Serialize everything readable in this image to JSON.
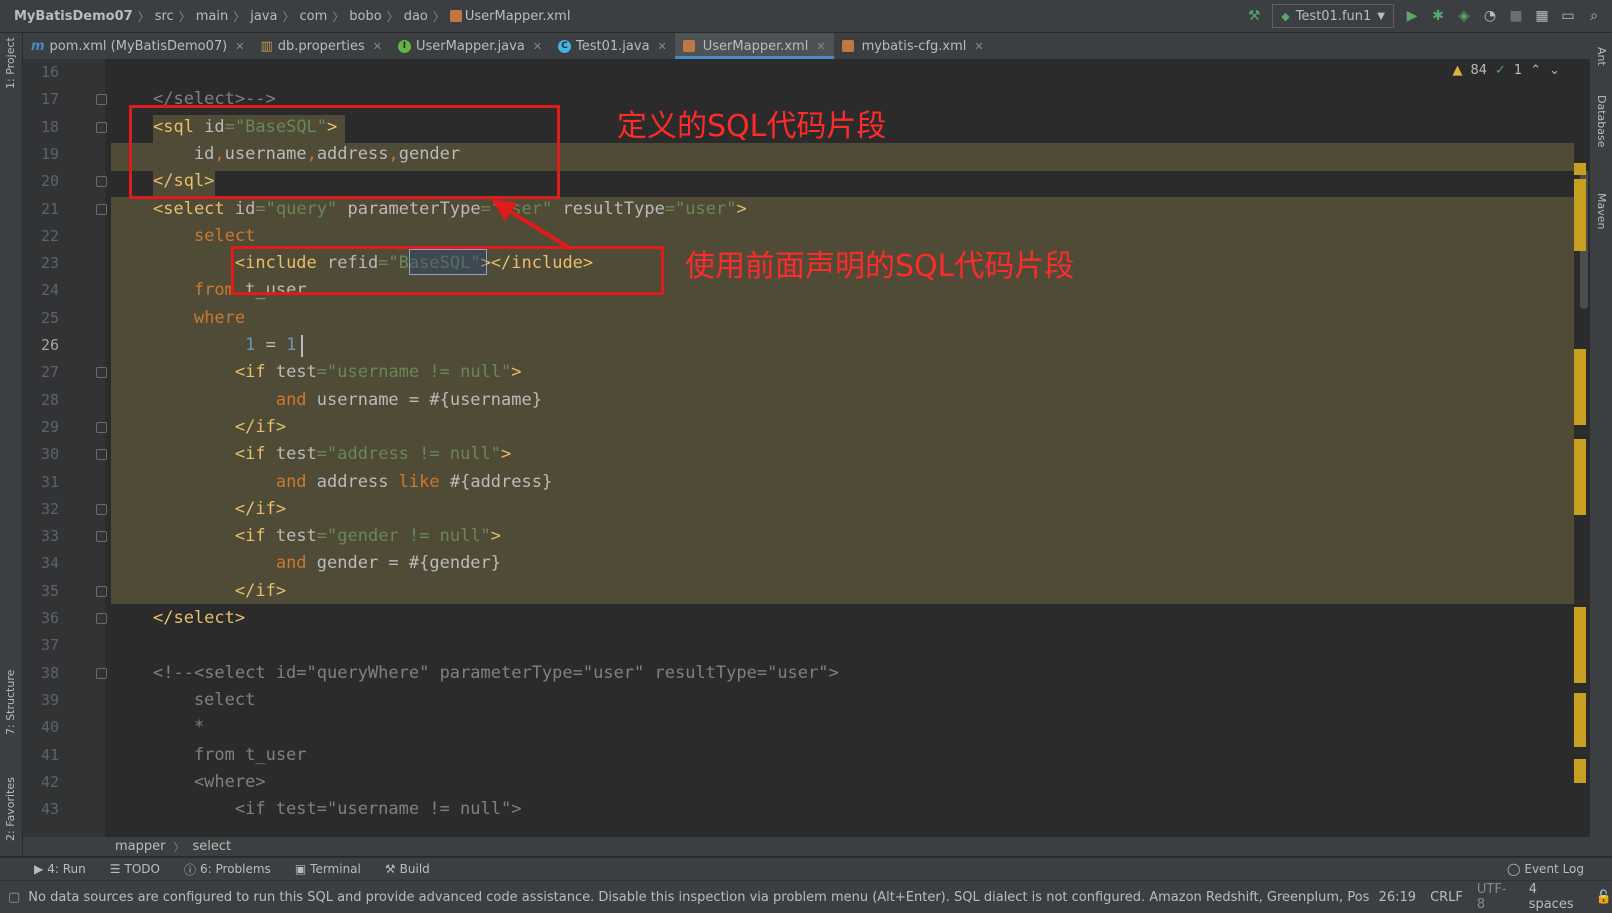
{
  "breadcrumbs": [
    "MyBatisDemo07",
    "src",
    "main",
    "java",
    "com",
    "bobo",
    "dao",
    "UserMapper.xml"
  ],
  "run_config": "Test01.fun1",
  "tabs": [
    {
      "label": "pom.xml (MyBatisDemo07)",
      "icon": "maven-icon",
      "active": false
    },
    {
      "label": "db.properties",
      "icon": "properties-icon",
      "active": false
    },
    {
      "label": "UserMapper.java",
      "icon": "interface-icon",
      "active": false
    },
    {
      "label": "Test01.java",
      "icon": "class-icon",
      "active": false
    },
    {
      "label": "UserMapper.xml",
      "icon": "xml-icon",
      "active": true
    },
    {
      "label": "mybatis-cfg.xml",
      "icon": "xml-icon",
      "active": false
    }
  ],
  "left_strip": {
    "project": "1: Project",
    "structure": "7: Structure",
    "favorites": "2: Favorites"
  },
  "right_strip": {
    "ant": "Ant",
    "database": "Database",
    "maven": "Maven"
  },
  "inspections": {
    "warnings": "84",
    "ok": "1"
  },
  "current_line": 26,
  "lines": [
    {
      "n": "16",
      "html": ""
    },
    {
      "n": "17",
      "html": "<span class='cmt'>&lt;/select&gt;--&gt;</span>"
    },
    {
      "n": "18",
      "html": "<span class='tag'>&lt;sql </span><span class='attr'>id</span><span class='val'>=\"BaseSQL\"</span><span class='tag'>&gt;</span>"
    },
    {
      "n": "19",
      "html": "    id<span class='kw'>,</span>username<span class='kw'>,</span>address<span class='kw'>,</span>gender"
    },
    {
      "n": "20",
      "html": "<span class='tag'>&lt;/sql&gt;</span>"
    },
    {
      "n": "21",
      "html": "<span class='tag'>&lt;select </span><span class='attr'>id</span><span class='val'>=\"query\" </span><span class='attr'>parameterType</span><span class='val'>=\"user\" </span><span class='attr'>resultType</span><span class='val'>=\"user\"</span><span class='tag'>&gt;</span>"
    },
    {
      "n": "22",
      "html": "    <span class='kw'>select</span>"
    },
    {
      "n": "23",
      "html": "        <span class='tag'>&lt;include </span><span class='attr'>refid</span><span class='val'>=\"BaseSQL\"</span><span class='tag'>&gt;&lt;/include&gt;</span>"
    },
    {
      "n": "24",
      "html": "    <span class='kw'>from</span> t_user"
    },
    {
      "n": "25",
      "html": "    <span class='kw'>where</span>"
    },
    {
      "n": "26",
      "html": "         <span class='num'>1</span> = <span class='num'>1</span>"
    },
    {
      "n": "27",
      "html": "        <span class='tag'>&lt;if </span><span class='attr'>test</span><span class='val'>=\"username != null\"</span><span class='tag'>&gt;</span>"
    },
    {
      "n": "28",
      "html": "            <span class='kw'>and</span> username = #{username}"
    },
    {
      "n": "29",
      "html": "        <span class='tag'>&lt;/if&gt;</span>"
    },
    {
      "n": "30",
      "html": "        <span class='tag'>&lt;if </span><span class='attr'>test</span><span class='val'>=\"address != null\"</span><span class='tag'>&gt;</span>"
    },
    {
      "n": "31",
      "html": "            <span class='kw'>and</span> address <span class='kw'>like</span> #{address}"
    },
    {
      "n": "32",
      "html": "        <span class='tag'>&lt;/if&gt;</span>"
    },
    {
      "n": "33",
      "html": "        <span class='tag'>&lt;if </span><span class='attr'>test</span><span class='val'>=\"gender != null\"</span><span class='tag'>&gt;</span>"
    },
    {
      "n": "34",
      "html": "            <span class='kw'>and</span> gender = #{gender}"
    },
    {
      "n": "35",
      "html": "        <span class='tag'>&lt;/if&gt;</span>"
    },
    {
      "n": "36",
      "html": "<span class='tag'>&lt;/select&gt;</span>"
    },
    {
      "n": "37",
      "html": ""
    },
    {
      "n": "38",
      "html": "<span class='cmt'>&lt;!--&lt;select id=\"queryWhere\" parameterType=\"user\" resultType=\"user\"&gt;</span>"
    },
    {
      "n": "39",
      "html": "<span class='cmt'>    select</span>"
    },
    {
      "n": "40",
      "html": "<span class='cmt'>    *</span>"
    },
    {
      "n": "41",
      "html": "<span class='cmt'>    from t_user</span>"
    },
    {
      "n": "42",
      "html": "<span class='cmt'>    &lt;where&gt;</span>"
    },
    {
      "n": "43",
      "html": "<span class='cmt'>        &lt;if test=\"username != null\"&gt;</span>"
    }
  ],
  "annotations": {
    "define": "定义的SQL代码片段",
    "use": "使用前面声明的SQL代码片段"
  },
  "code_breadcrumb": [
    "mapper",
    "select"
  ],
  "tool_windows": [
    {
      "label": "4: Run",
      "icon": "run-icon"
    },
    {
      "label": "TODO",
      "icon": "todo-icon"
    },
    {
      "label": "6: Problems",
      "icon": "problems-icon"
    },
    {
      "label": "Terminal",
      "icon": "terminal-icon"
    },
    {
      "label": "Build",
      "icon": "build-icon"
    }
  ],
  "event_log": "Event Log",
  "status": {
    "message": "No data sources are configured to run this SQL and provide advanced code assistance. Disable this inspection via problem menu (Alt+Enter). SQL dialect is not configured. Amazon Redshift, Greenplum, PostgreSQL match best.",
    "position": "26:19",
    "line_sep": "CRLF",
    "encoding": "UTF-8",
    "indent": "4 spaces"
  },
  "colors": {
    "accent": "#4a88c7",
    "annotation": "#e01b1b",
    "highlight": "#4f4b36"
  }
}
